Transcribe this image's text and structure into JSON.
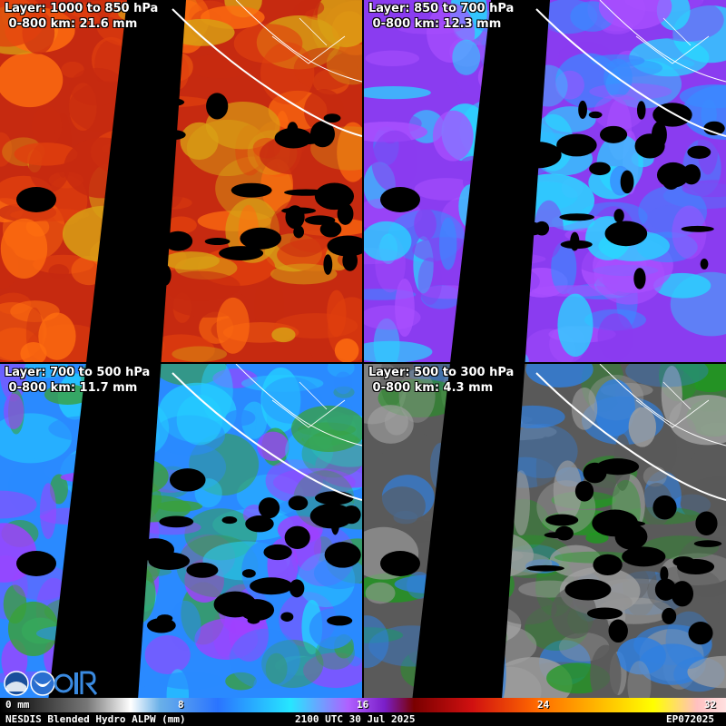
{
  "panels": [
    {
      "layer_label": "Layer: 1000 to 850 hPa",
      "value_label": "0-800 km: 21.6 mm",
      "palette": [
        "#c62a10",
        "#e0400e",
        "#ff6e10",
        "#d8a015"
      ]
    },
    {
      "layer_label": "Layer: 850 to 700 hPa",
      "value_label": "0-800 km: 12.3 mm",
      "palette": [
        "#8a3cf0",
        "#3a8aff",
        "#28d8ff",
        "#aa50ff"
      ]
    },
    {
      "layer_label": "Layer: 700 to 500 hPa",
      "value_label": "0-800 km: 11.7 mm",
      "palette": [
        "#2a8aff",
        "#24d0ff",
        "#3aa03a",
        "#a040ff"
      ]
    },
    {
      "layer_label": "Layer: 500 to 300 hPa",
      "value_label": "0-800 km: 4.3 mm",
      "palette": [
        "#5a5a5a",
        "#a0a0a0",
        "#1f9a1f",
        "#3080e0"
      ]
    }
  ],
  "colorbar": {
    "ticks": [
      {
        "label": "0 mm",
        "value": 0
      },
      {
        "label": "8",
        "value": 8
      },
      {
        "label": "16",
        "value": 16
      },
      {
        "label": "24",
        "value": 24
      },
      {
        "label": "32",
        "value": 32
      }
    ],
    "max": 32
  },
  "footer": {
    "product": "NESDIS Blended Hydro ALPW (mm)",
    "time": "2100 UTC 30 Jul 2025",
    "storm_id": "EP072025"
  },
  "icons": {
    "logo_a": "nesdis-logo-icon",
    "logo_b": "noaa-logo-icon",
    "logo_c": "cira-logo-icon"
  }
}
